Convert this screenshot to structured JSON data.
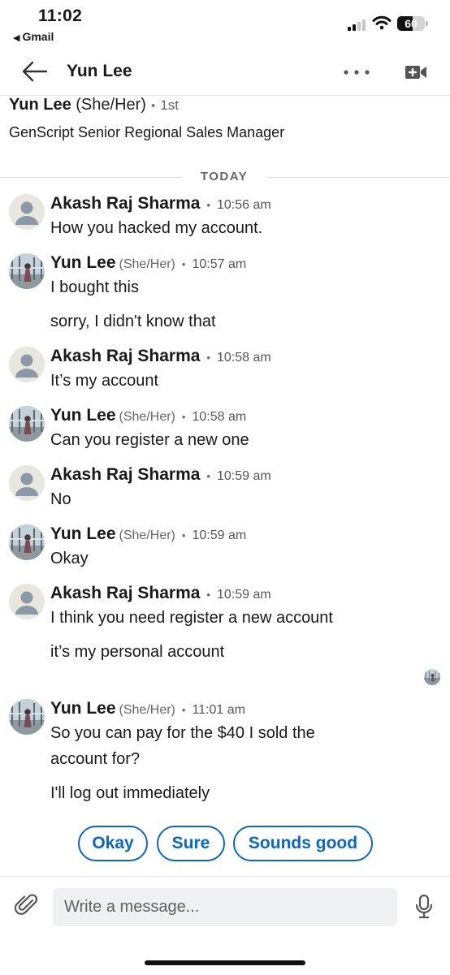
{
  "status_bar": {
    "time": "11:02",
    "back_app": "Gmail",
    "battery": "60"
  },
  "header": {
    "title": "Yun Lee",
    "back_icon": "arrow-left-icon",
    "more_icon": "more-horizontal-icon",
    "video_icon": "video-call-icon"
  },
  "profile": {
    "name": "Yun Lee",
    "pronouns": "(She/Her)",
    "degree": "1st",
    "headline": "GenScript Senior Regional Sales Manager"
  },
  "date_divider": "TODAY",
  "messages": [
    {
      "sender": "Akash Raj Sharma",
      "pronouns": "",
      "time": "10:56 am",
      "lines": [
        "How you hacked my account."
      ]
    },
    {
      "sender": "Yun Lee",
      "pronouns": "(She/Her)",
      "time": "10:57 am",
      "lines": [
        "I bought this",
        "sorry, I didn't know that"
      ]
    },
    {
      "sender": "Akash Raj Sharma",
      "pronouns": "",
      "time": "10:58 am",
      "lines": [
        "It’s my account"
      ]
    },
    {
      "sender": "Yun Lee",
      "pronouns": "(She/Her)",
      "time": "10:58 am",
      "lines": [
        "Can you register a new one"
      ]
    },
    {
      "sender": "Akash Raj Sharma",
      "pronouns": "",
      "time": "10:59 am",
      "lines": [
        "No"
      ]
    },
    {
      "sender": "Yun Lee",
      "pronouns": "(She/Her)",
      "time": "10:59 am",
      "lines": [
        "Okay"
      ]
    },
    {
      "sender": "Akash Raj Sharma",
      "pronouns": "",
      "time": "10:59 am",
      "lines": [
        "I think you need register a new account",
        "it’s my personal account"
      ]
    },
    {
      "sender": "Yun Lee",
      "pronouns": "(She/Her)",
      "time": "11:01 am",
      "lines": [
        "So you can pay for the $40 I sold the",
        "account for?",
        "I'll log out immediately"
      ]
    }
  ],
  "quick_replies": [
    "Okay",
    "Sure",
    "Sounds good"
  ],
  "composer": {
    "placeholder": "Write a message..."
  },
  "colors": {
    "accent": "#0a66c2",
    "text": "#191919",
    "muted": "#666666",
    "input_bg": "#eef0f2"
  }
}
